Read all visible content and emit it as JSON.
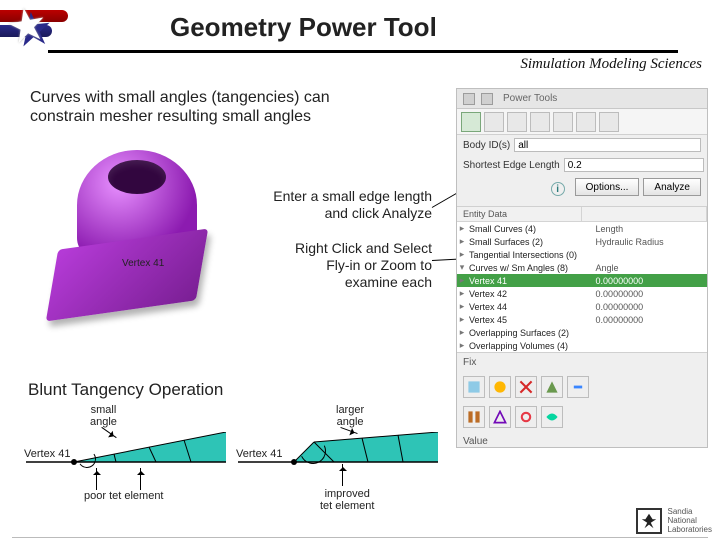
{
  "title": "Geometry Power Tool",
  "subtitle": "Simulation Modeling Sciences",
  "description": "Curves with small angles (tangencies) can constrain mesher resulting small angles",
  "hints": {
    "enter": "Enter a small edge length and click Analyze",
    "rightclick": "Right Click and Select Fly-in or Zoom to examine each"
  },
  "part_vertex_label": "Vertex 41",
  "panel": {
    "tab_title": "Power Tools",
    "toolbar_icons": [
      "geometry",
      "mesh",
      "select",
      "volume",
      "inspect",
      "measure",
      "color",
      "settings"
    ],
    "body_id_label": "Body ID(s)",
    "body_id_value": "all",
    "edge_len_label": "Shortest Edge Length",
    "edge_len_value": "0.2",
    "options_btn": "Options...",
    "analyze_btn": "Analyze",
    "tree_headers": [
      "Entity Data",
      ""
    ],
    "tree": [
      {
        "label": "Small Curves (4)",
        "val": "Length",
        "depth": 1,
        "expand": "▸"
      },
      {
        "label": "Small Surfaces (2)",
        "val": "Hydraulic Radius",
        "depth": 1,
        "expand": "▸"
      },
      {
        "label": "Tangential Intersections (0)",
        "val": "",
        "depth": 1,
        "expand": "▸"
      },
      {
        "label": "Curves w/ Sm Angles (8)",
        "val": "Angle",
        "depth": 1,
        "expand": "▾"
      },
      {
        "label": "Vertex 41",
        "val": "0.00000000",
        "depth": 2,
        "expand": "▸",
        "hi": true
      },
      {
        "label": "Vertex 42",
        "val": "0.00000000",
        "depth": 2,
        "expand": "▸"
      },
      {
        "label": "Vertex 44",
        "val": "0.00000000",
        "depth": 2,
        "expand": "▸"
      },
      {
        "label": "Vertex 45",
        "val": "0.00000000",
        "depth": 2,
        "expand": "▸"
      },
      {
        "label": "Overlapping Surfaces (2)",
        "val": "",
        "depth": 1,
        "expand": "▸"
      },
      {
        "label": "Overlapping Volumes (4)",
        "val": "",
        "depth": 1,
        "expand": "▸"
      }
    ],
    "fix_label": "Fix",
    "value_label": "Value"
  },
  "section_title": "Blunt Tangency Operation",
  "small_angle_label": "small\nangle",
  "larger_angle_label": "larger\nangle",
  "vertex_label": "Vertex 41",
  "poor_caption": "poor tet element",
  "improved_caption": "improved\ntet element",
  "logo": {
    "line1": "Sandia",
    "line2": "National",
    "line3": "Laboratories"
  }
}
